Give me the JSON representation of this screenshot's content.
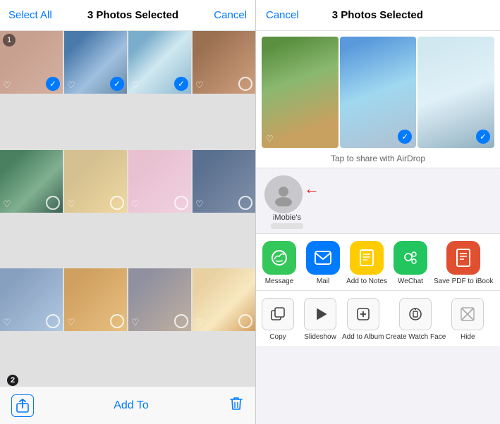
{
  "left": {
    "header": {
      "select_all": "Select All",
      "title": "3 Photos Selected",
      "cancel": "Cancel"
    },
    "footer": {
      "add_to": "Add To"
    },
    "badge": "2",
    "grid": [
      {
        "id": 1,
        "color": "c1",
        "selected": true,
        "num": "1"
      },
      {
        "id": 2,
        "color": "c2",
        "selected": true
      },
      {
        "id": 3,
        "color": "c3",
        "selected": true
      },
      {
        "id": 4,
        "color": "c4",
        "selected": false
      },
      {
        "id": 5,
        "color": "c5",
        "selected": false
      },
      {
        "id": 6,
        "color": "c6",
        "selected": false
      },
      {
        "id": 7,
        "color": "c7",
        "selected": false
      },
      {
        "id": 8,
        "color": "c8",
        "selected": false
      },
      {
        "id": 9,
        "color": "c9",
        "selected": false
      },
      {
        "id": 10,
        "color": "c10",
        "selected": false
      },
      {
        "id": 11,
        "color": "c11",
        "selected": false
      },
      {
        "id": 12,
        "color": "c12",
        "selected": false
      }
    ]
  },
  "right": {
    "header": {
      "cancel": "Cancel",
      "title": "3 Photos Selected"
    },
    "airdrop_hint": "Tap to share with AirDrop",
    "contact_name": "iMobie's",
    "strip": [
      {
        "color": "s1"
      },
      {
        "color": "s2"
      },
      {
        "color": "s3"
      }
    ],
    "share_items": [
      {
        "label": "Message",
        "bg": "#34c759",
        "icon": "💬"
      },
      {
        "label": "Mail",
        "bg": "#007aff",
        "icon": "✉️"
      },
      {
        "label": "Add to Notes",
        "bg": "#ffcc00",
        "icon": "📝"
      },
      {
        "label": "WeChat",
        "bg": "#22c55e",
        "icon": "💬"
      },
      {
        "label": "Save PDF\nto iBook",
        "bg": "#e05030",
        "icon": "📖"
      }
    ],
    "action_items": [
      {
        "label": "Copy",
        "icon": "⧉"
      },
      {
        "label": "Slideshow",
        "icon": "▶"
      },
      {
        "label": "Add to Album",
        "icon": "➕"
      },
      {
        "label": "Create\nWatch Face",
        "icon": "⌚"
      },
      {
        "label": "Hide",
        "icon": "⊘"
      }
    ]
  }
}
